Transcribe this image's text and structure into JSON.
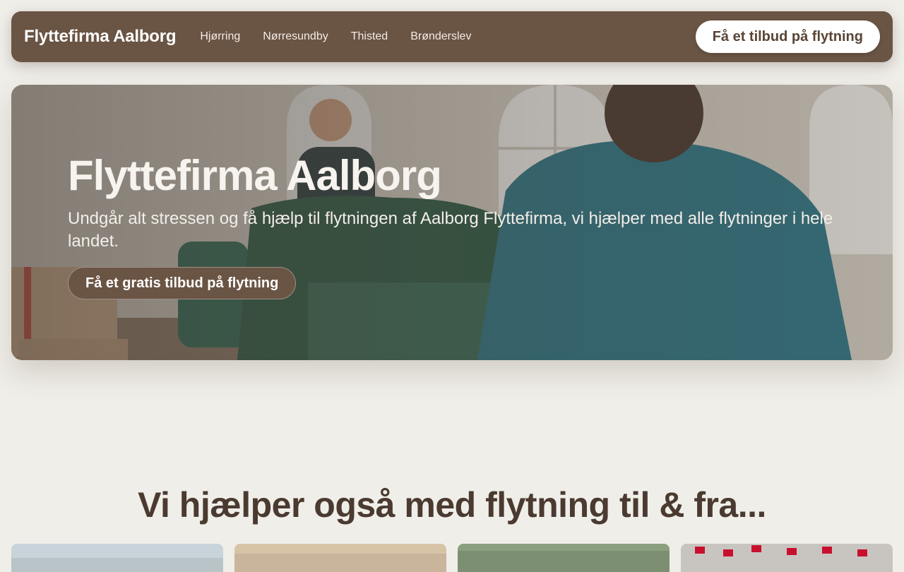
{
  "nav": {
    "brand": "Flyttefirma Aalborg",
    "links": [
      "Hjørring",
      "Nørresundby",
      "Thisted",
      "Brønderslev"
    ],
    "cta": "Få et tilbud på flytning"
  },
  "hero": {
    "title": "Flyttefirma Aalborg",
    "subtitle": "Undgår alt stressen og få hjælp til flytningen af Aalborg Flyttefirma, vi hjælper med alle flytninger i hele landet.",
    "cta": "Få et gratis tilbud på flytning"
  },
  "section": {
    "title": "Vi hjælper også med flytning til & fra..."
  },
  "colors": {
    "brand_brown": "#6a5444",
    "page_bg": "#f0eee9",
    "heading_brown": "#4a3a30"
  }
}
